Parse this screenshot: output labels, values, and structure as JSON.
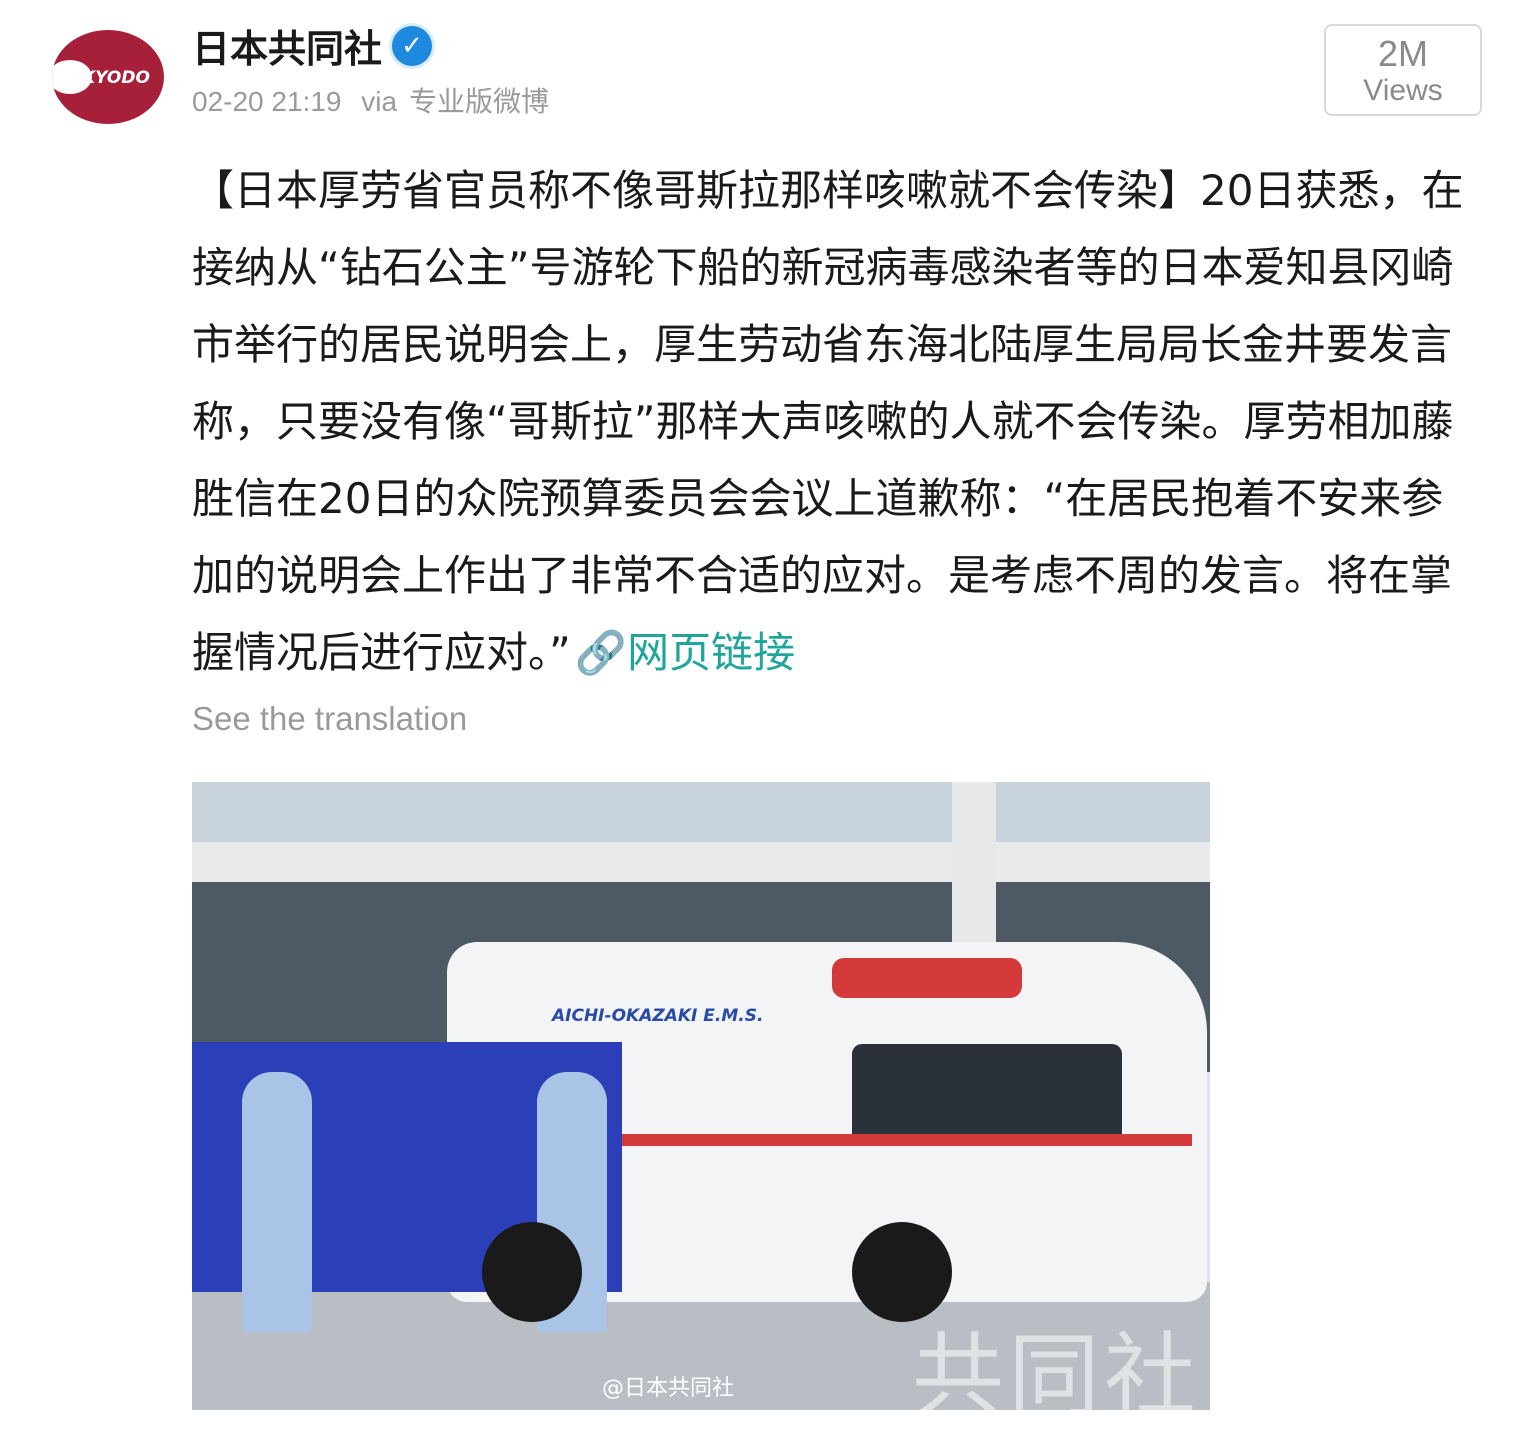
{
  "header": {
    "avatar_text": "KYODO",
    "account_name": "日本共同社",
    "verified_icon": "verified-check-icon",
    "timestamp": "02-20 21:19",
    "via": "via",
    "client": "专业版微博"
  },
  "views": {
    "count": "2M",
    "label": "Views"
  },
  "post": {
    "body": "【日本厚劳省官员称不像哥斯拉那样咳嗽就不会传染】20日获悉，在接纳从“钻石公主”号游轮下船的新冠病毒感染者等的日本爱知县冈崎市举行的居民说明会上，厚生劳动省东海北陆厚生局局长金井要发言称，只要没有像“哥斯拉”那样大声咳嗽的人就不会传染。厚劳相加藤胜信在20日的众院预算委员会会议上道歉称：“在居民抱着不安来参加的说明会上作出了非常不合适的应对。是考虑不周的发言。将在掌握情况后进行应对。”",
    "link_icon": "link-icon",
    "link_label": "网页链接",
    "translate": "See the translation"
  },
  "photo": {
    "vehicle_text": "AICHI-OKAZAKI E.M.S.",
    "weibo_watermark": "@日本共同社",
    "kyodo_watermark": "共同社"
  },
  "colors": {
    "brand_red": "#a6203a",
    "link_teal": "#1fa59a",
    "verified_blue": "#1d8ae0",
    "meta_gray": "#9a9a9a"
  }
}
